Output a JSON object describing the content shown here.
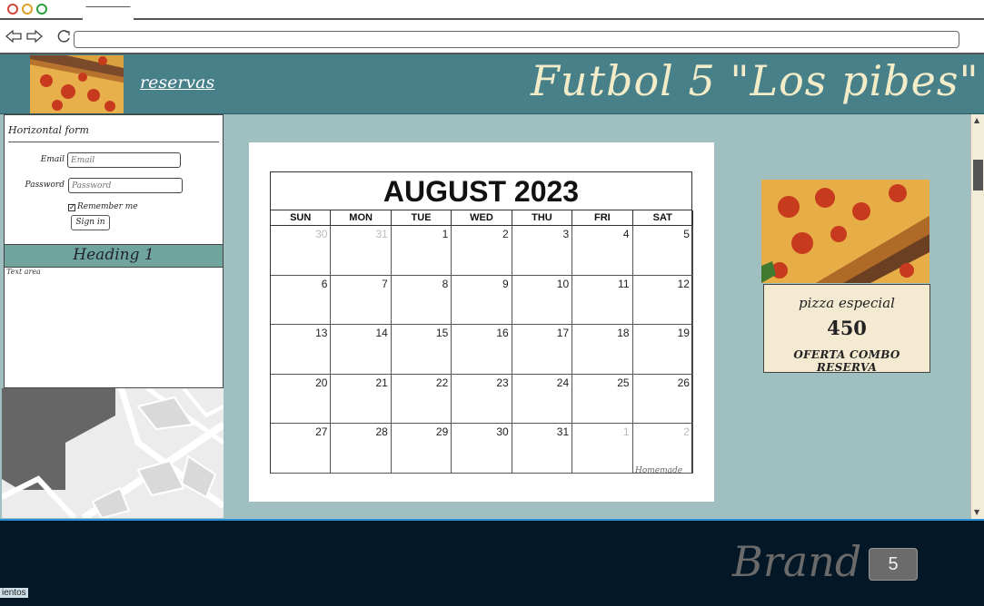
{
  "browser": {
    "window_controls": [
      "close",
      "minimize",
      "maximize"
    ],
    "back_icon": "back-arrow-icon",
    "forward_icon": "forward-arrow-icon",
    "reload_icon": "reload-icon",
    "address": ""
  },
  "header": {
    "nav_link": "reservas",
    "site_title": "Futbol 5 \"Los pibes\""
  },
  "form": {
    "title": "Horizontal form",
    "email_label": "Email",
    "email_placeholder": "Email",
    "password_label": "Password",
    "password_placeholder": "Password",
    "remember_label": "Remember me",
    "remember_checked": true,
    "submit_label": "Sign in"
  },
  "heading": "Heading 1",
  "textarea_label": "Text area",
  "calendar": {
    "title": "AUGUST 2023",
    "weekdays": [
      "SUN",
      "MON",
      "TUE",
      "WED",
      "THU",
      "FRI",
      "SAT"
    ],
    "weeks": [
      [
        {
          "d": "30",
          "m": true
        },
        {
          "d": "31",
          "m": true
        },
        {
          "d": "1"
        },
        {
          "d": "2"
        },
        {
          "d": "3"
        },
        {
          "d": "4"
        },
        {
          "d": "5"
        }
      ],
      [
        {
          "d": "6"
        },
        {
          "d": "7"
        },
        {
          "d": "8"
        },
        {
          "d": "9"
        },
        {
          "d": "10"
        },
        {
          "d": "11"
        },
        {
          "d": "12"
        }
      ],
      [
        {
          "d": "13"
        },
        {
          "d": "14"
        },
        {
          "d": "15"
        },
        {
          "d": "16"
        },
        {
          "d": "17"
        },
        {
          "d": "18"
        },
        {
          "d": "19"
        }
      ],
      [
        {
          "d": "20"
        },
        {
          "d": "21"
        },
        {
          "d": "22"
        },
        {
          "d": "23"
        },
        {
          "d": "24"
        },
        {
          "d": "25"
        },
        {
          "d": "26"
        }
      ],
      [
        {
          "d": "27"
        },
        {
          "d": "28"
        },
        {
          "d": "29"
        },
        {
          "d": "30"
        },
        {
          "d": "31"
        },
        {
          "d": "1",
          "m": true
        },
        {
          "d": "2",
          "m": true
        }
      ]
    ],
    "watermark": "Homemade"
  },
  "promo": {
    "name": "pizza especial",
    "price": "450",
    "offer": "OFERTA COMBO RESERVA"
  },
  "footer": {
    "brand": "Brand",
    "badge": "5",
    "cut_text": "ientos"
  },
  "colors": {
    "header": "#48808a",
    "main_bg": "#9fbfc0",
    "heading_band": "#6fa59c",
    "promo_card": "#f4ead2",
    "footer": "#031726",
    "title_text": "#f3ecc8"
  }
}
